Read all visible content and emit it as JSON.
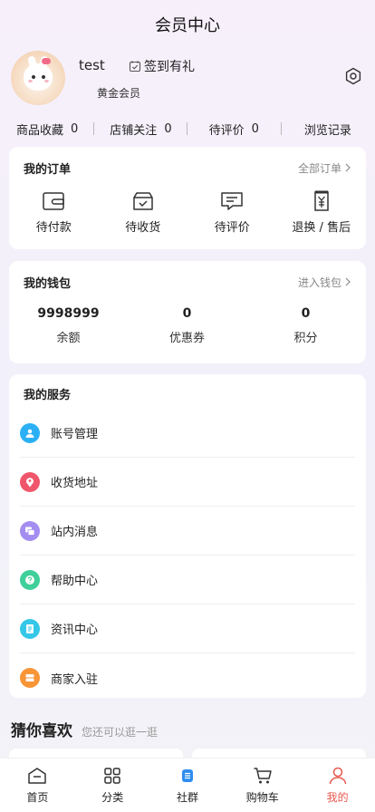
{
  "page": {
    "title": "会员中心"
  },
  "profile": {
    "username": "test",
    "signin_label": "签到有礼",
    "level": "黄金会员"
  },
  "stats": [
    {
      "label": "商品收藏",
      "value": "0"
    },
    {
      "label": "店铺关注",
      "value": "0"
    },
    {
      "label": "待评价",
      "value": "0"
    },
    {
      "label": "浏览记录",
      "value": ""
    }
  ],
  "orders": {
    "title": "我的订单",
    "link": "全部订单",
    "items": [
      {
        "label": "待付款",
        "icon": "wallet-icon"
      },
      {
        "label": "待收货",
        "icon": "package-icon"
      },
      {
        "label": "待评价",
        "icon": "comment-icon"
      },
      {
        "label": "退换 / 售后",
        "icon": "refund-icon"
      }
    ]
  },
  "wallet": {
    "title": "我的钱包",
    "link": "进入钱包",
    "items": [
      {
        "value": "9998999",
        "label": "余额"
      },
      {
        "value": "0",
        "label": "优惠券"
      },
      {
        "value": "0",
        "label": "积分"
      }
    ]
  },
  "services": {
    "title": "我的服务",
    "items": [
      {
        "label": "账号管理",
        "icon": "user-icon",
        "color": "#2bb0f5"
      },
      {
        "label": "收货地址",
        "icon": "location-icon",
        "color": "#f0566b"
      },
      {
        "label": "站内消息",
        "icon": "message-icon",
        "color": "#a48df0"
      },
      {
        "label": "帮助中心",
        "icon": "help-icon",
        "color": "#3fcf9a"
      },
      {
        "label": "资讯中心",
        "icon": "news-icon",
        "color": "#34c7e8"
      },
      {
        "label": "商家入驻",
        "icon": "store-icon",
        "color": "#f79537"
      }
    ]
  },
  "guess": {
    "title": "猜你喜欢",
    "subtitle": "您还可以逛一逛"
  },
  "tabbar": [
    {
      "label": "首页",
      "icon": "home-icon"
    },
    {
      "label": "分类",
      "icon": "category-icon"
    },
    {
      "label": "社群",
      "icon": "community-icon"
    },
    {
      "label": "购物车",
      "icon": "cart-icon"
    },
    {
      "label": "我的",
      "icon": "profile-icon",
      "active": true
    }
  ],
  "colors": {
    "accent": "#e8584f",
    "community": "#2f8ef0"
  }
}
